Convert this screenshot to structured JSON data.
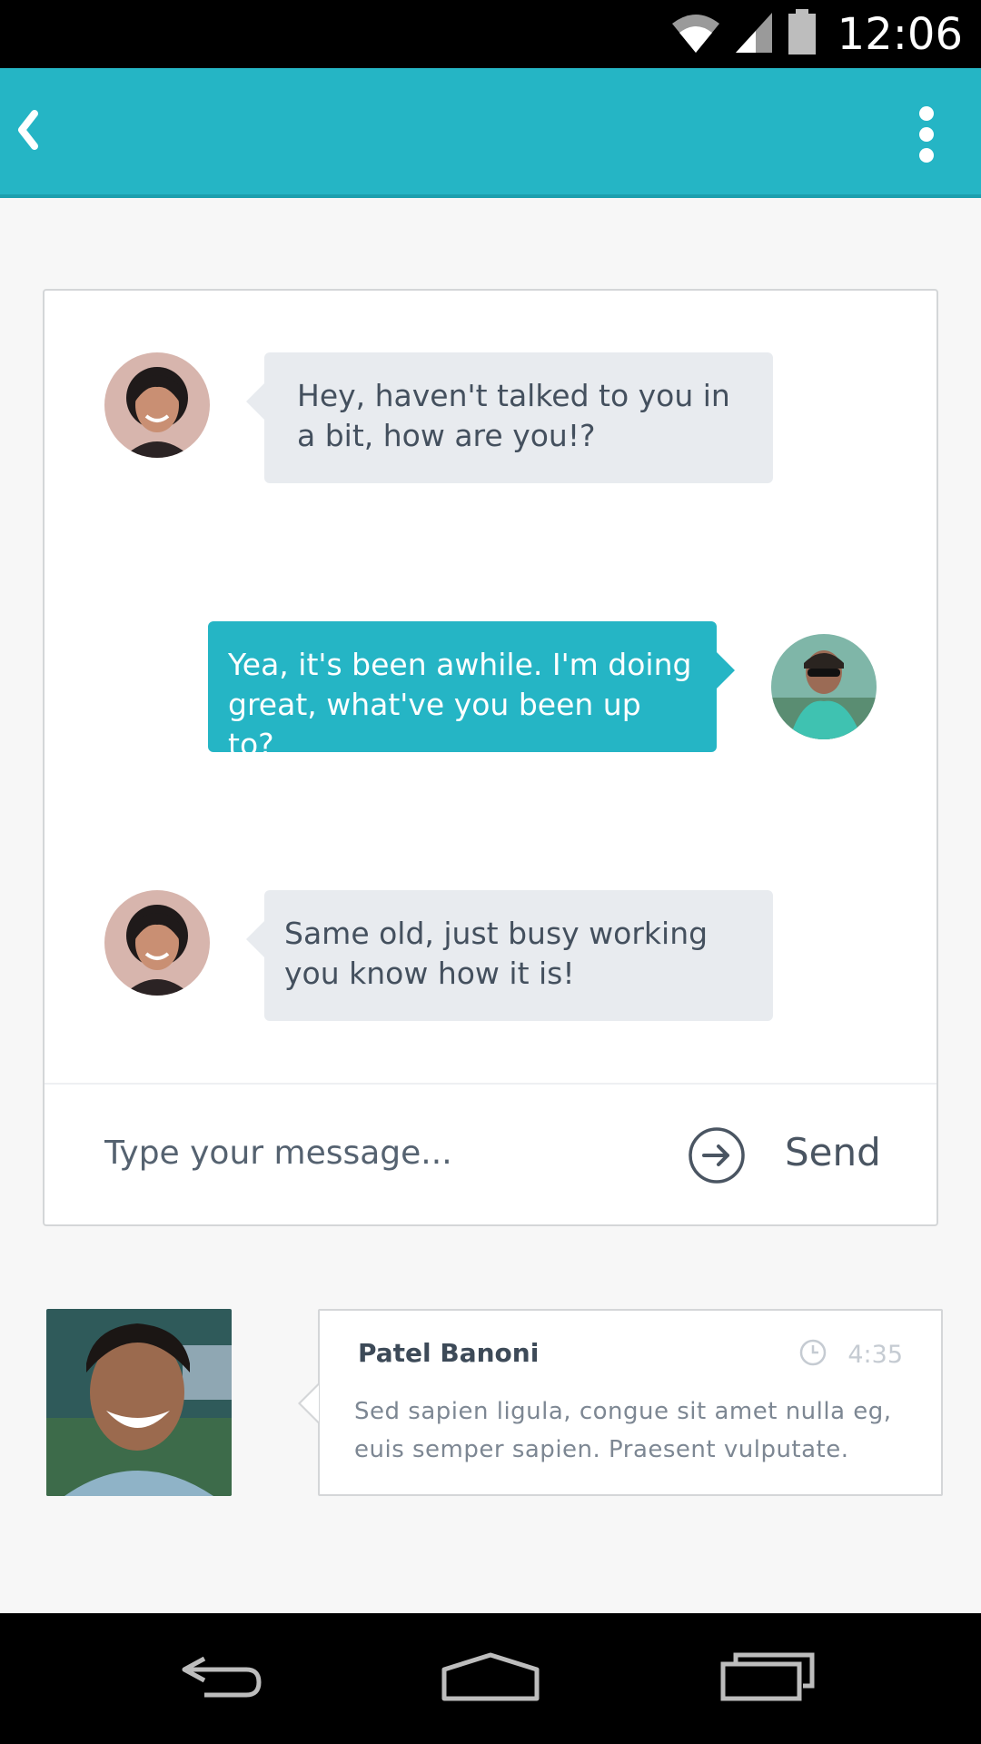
{
  "status_bar": {
    "time": "12:06"
  },
  "messages": [
    {
      "direction": "incoming",
      "text": "Hey, haven't talked to you in a bit, how are you!?"
    },
    {
      "direction": "outgoing",
      "text": "Yea, it's been awhile. I'm doing great, what've you been up to?"
    },
    {
      "direction": "incoming",
      "text": "Same old, just busy working you know how it is!"
    }
  ],
  "composer": {
    "placeholder": "Type your message...",
    "send_label": "Send"
  },
  "preview": {
    "name": "Patel Banoni",
    "time": "4:35",
    "text": "Sed sapien ligula, congue sit amet nulla eg, euis semper sapien. Praesent vulputate."
  },
  "colors": {
    "accent": "#25b5c5",
    "incoming_bubble": "#e8ebef",
    "text_dark": "#44505e"
  },
  "icons": {
    "status": [
      "wifi-icon",
      "signal-icon",
      "battery-icon"
    ],
    "app_bar": [
      "back-icon",
      "overflow-menu-icon"
    ],
    "nav": [
      "nav-back-icon",
      "nav-home-icon",
      "nav-recents-icon"
    ]
  }
}
